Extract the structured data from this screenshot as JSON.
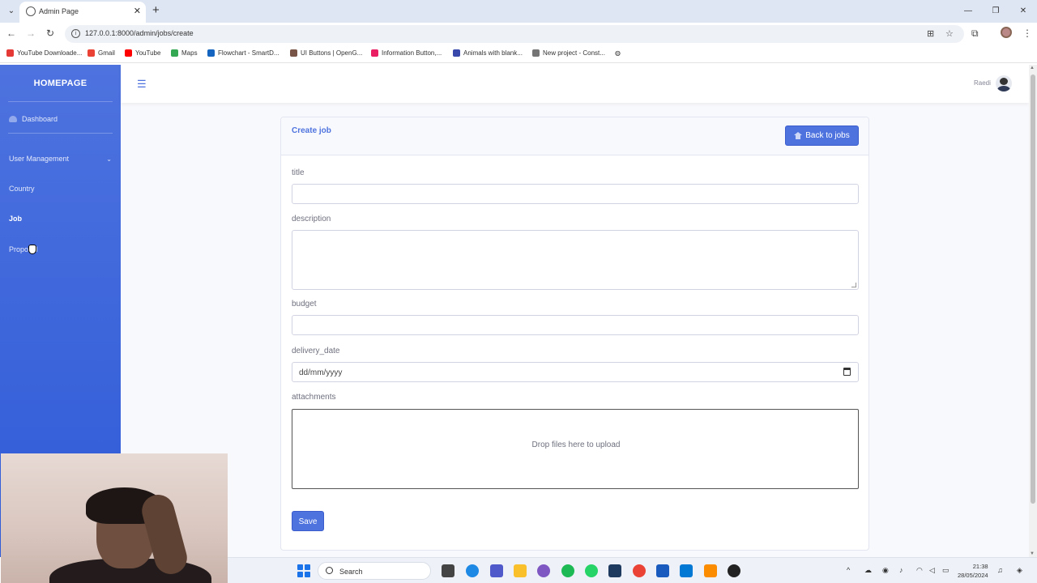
{
  "browser": {
    "tab_title": "Admin Page",
    "url": "127.0.0.1:8000/admin/jobs/create",
    "bookmarks": [
      {
        "label": "YouTube Downloade...",
        "color": "#e53935"
      },
      {
        "label": "Gmail",
        "color": "#ea4335"
      },
      {
        "label": "YouTube",
        "color": "#ff0000"
      },
      {
        "label": "Maps",
        "color": "#34a853"
      },
      {
        "label": "Flowchart - SmartD...",
        "color": "#1565c0"
      },
      {
        "label": "UI Buttons | OpenG...",
        "color": "#795548"
      },
      {
        "label": "Information Button,...",
        "color": "#e91e63"
      },
      {
        "label": "Animals with blank...",
        "color": "#3949ab"
      },
      {
        "label": "New project - Const...",
        "color": "#757575"
      }
    ]
  },
  "sidebar": {
    "brand": "HOMEPAGE",
    "items": [
      {
        "label": "Dashboard"
      },
      {
        "label": "User Management"
      },
      {
        "label": "Country"
      },
      {
        "label": "Job"
      },
      {
        "label": "Proposal"
      }
    ]
  },
  "topbar": {
    "user_name": "Raedi"
  },
  "form": {
    "card_title": "Create job",
    "back_button": "Back to jobs",
    "fields": {
      "title_label": "title",
      "description_label": "description",
      "budget_label": "budget",
      "delivery_date_label": "delivery_date",
      "delivery_date_placeholder": "dd/mm/yyyy",
      "attachments_label": "attachments"
    },
    "dropzone_text": "Drop files here to upload",
    "save_button": "Save"
  },
  "taskbar": {
    "search_placeholder": "Search",
    "time": "21:38",
    "date": "28/05/2024"
  },
  "colors": {
    "primary": "#4e73df",
    "sidebar_bg": "#3a62db"
  }
}
